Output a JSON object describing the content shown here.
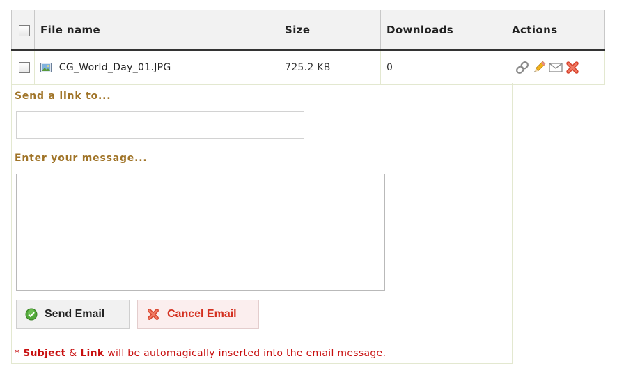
{
  "table": {
    "headers": {
      "file_name": "File name",
      "size": "Size",
      "downloads": "Downloads",
      "actions": "Actions"
    },
    "rows": [
      {
        "file_name": "CG_World_Day_01.JPG",
        "size": "725.2 KB",
        "downloads": "0"
      }
    ],
    "action_icons": [
      "link-icon",
      "edit-pencil-icon",
      "email-icon",
      "delete-icon"
    ]
  },
  "email_form": {
    "send_to_label": "Send a link to...",
    "send_to_value": "",
    "message_label": "Enter your message...",
    "message_value": "",
    "send_button": "Send Email",
    "cancel_button": "Cancel Email",
    "note": {
      "prefix": "* ",
      "subject": "Subject",
      "amp": " & ",
      "link": "Link",
      "suffix": " will be automagically inserted into the email message."
    }
  },
  "colors": {
    "label": "#a07428",
    "note": "#c81010",
    "cancel_text": "#d43121",
    "header_bg": "#f2f2f2"
  }
}
